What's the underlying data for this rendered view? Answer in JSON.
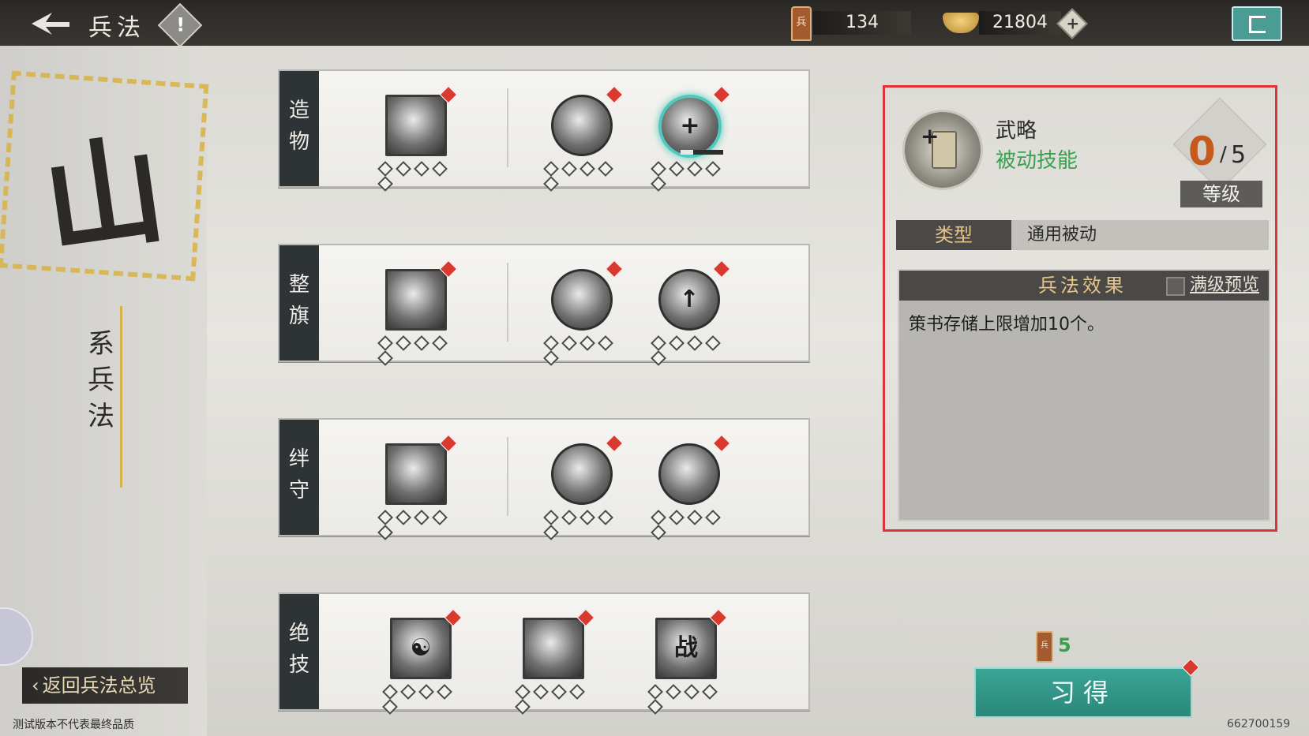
{
  "header": {
    "title": "兵法",
    "info_symbol": "!",
    "tally_icon_text": "兵",
    "tally_count": "134",
    "ingot_count": "21804",
    "plus_symbol": "+"
  },
  "left": {
    "seal_char": "山",
    "series_chars": [
      "系",
      "兵",
      "法"
    ],
    "return_label": "返回兵法总览",
    "footer_note": "测试版本不代表最终品质",
    "build_no": "662700159"
  },
  "rows": [
    {
      "label": [
        "造",
        "物"
      ],
      "skills": [
        {
          "shape": "square",
          "glyph": "",
          "selected": false
        },
        {
          "shape": "round",
          "glyph": "",
          "selected": false
        },
        {
          "shape": "round",
          "glyph": "+",
          "selected": true
        }
      ]
    },
    {
      "label": [
        "整",
        "旗"
      ],
      "skills": [
        {
          "shape": "square",
          "glyph": "",
          "selected": false
        },
        {
          "shape": "round",
          "glyph": "",
          "selected": false
        },
        {
          "shape": "round",
          "glyph": "↑",
          "selected": false
        }
      ]
    },
    {
      "label": [
        "绊",
        "守"
      ],
      "skills": [
        {
          "shape": "square",
          "glyph": "",
          "selected": false
        },
        {
          "shape": "round",
          "glyph": "",
          "selected": false
        },
        {
          "shape": "round",
          "glyph": "",
          "selected": false
        }
      ]
    },
    {
      "label": [
        "绝",
        "技"
      ],
      "skills": [
        {
          "shape": "square",
          "glyph": "☯",
          "selected": false
        },
        {
          "shape": "square",
          "glyph": "",
          "selected": false
        },
        {
          "shape": "square",
          "glyph": "战",
          "selected": false
        }
      ]
    }
  ],
  "detail": {
    "name": "武略",
    "kind": "被动技能",
    "level_current": "0",
    "level_max": "5",
    "level_label": "等级",
    "type_key": "类型",
    "type_value": "通用被动",
    "effect_title": "兵法效果",
    "preview_label": "满级预览",
    "effect_text": "策书存储上限增加10个。"
  },
  "learn": {
    "cost_icon_text": "兵",
    "cost": "5",
    "label": "习得"
  },
  "colors": {
    "accent": "#3aa596",
    "gold": "#d9b245",
    "kind": "#3aa050",
    "highlight_border": "#e0323a",
    "red_dot": "#d93a2f"
  },
  "icons": [
    "back-arrow-icon",
    "info-icon",
    "tally-icon",
    "ingot-icon",
    "plus-icon",
    "exit-icon",
    "star-diamond-icon",
    "notification-dot-icon"
  ]
}
